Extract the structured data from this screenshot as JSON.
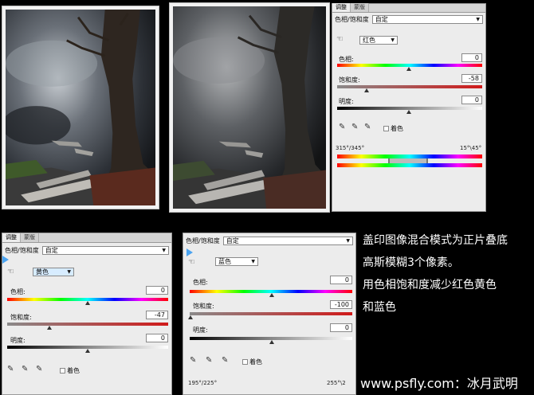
{
  "photos": [
    "original-photo",
    "processed-photo"
  ],
  "panel_top": {
    "tabs": [
      "调整",
      "蒙版"
    ],
    "title": "色相/饱和度",
    "preset": "自定",
    "channel": "红色",
    "hue_label": "色相:",
    "hue_value": "0",
    "sat_label": "饱和度:",
    "sat_value": "-58",
    "light_label": "明度:",
    "light_value": "0",
    "colorize_label": "着色",
    "range_left": "315°/345°",
    "range_right": "15°\\45°"
  },
  "panel_yellow": {
    "tabs": [
      "调整",
      "蒙版"
    ],
    "title": "色相/饱和度",
    "preset": "自定",
    "channel": "黄色",
    "hue_label": "色相:",
    "hue_value": "0",
    "sat_label": "饱和度:",
    "sat_value": "-47",
    "light_label": "明度:",
    "light_value": "0",
    "colorize_label": "着色"
  },
  "panel_blue": {
    "title": "色相/饱和度",
    "preset": "自定",
    "channel": "蓝色",
    "hue_label": "色相:",
    "hue_value": "0",
    "sat_label": "饱和度:",
    "sat_value": "-100",
    "light_label": "明度:",
    "light_value": "0",
    "colorize_label": "着色",
    "range_left": "195°/225°",
    "range_right": "255°\\2"
  },
  "caption_lines": [
    "盖印图像混合模式为正片叠底",
    "高斯模糊3个像素。",
    "用色相饱和度减少红色黄色",
    "和蓝色"
  ],
  "watermark": "www.psfly.com：冰月武明"
}
